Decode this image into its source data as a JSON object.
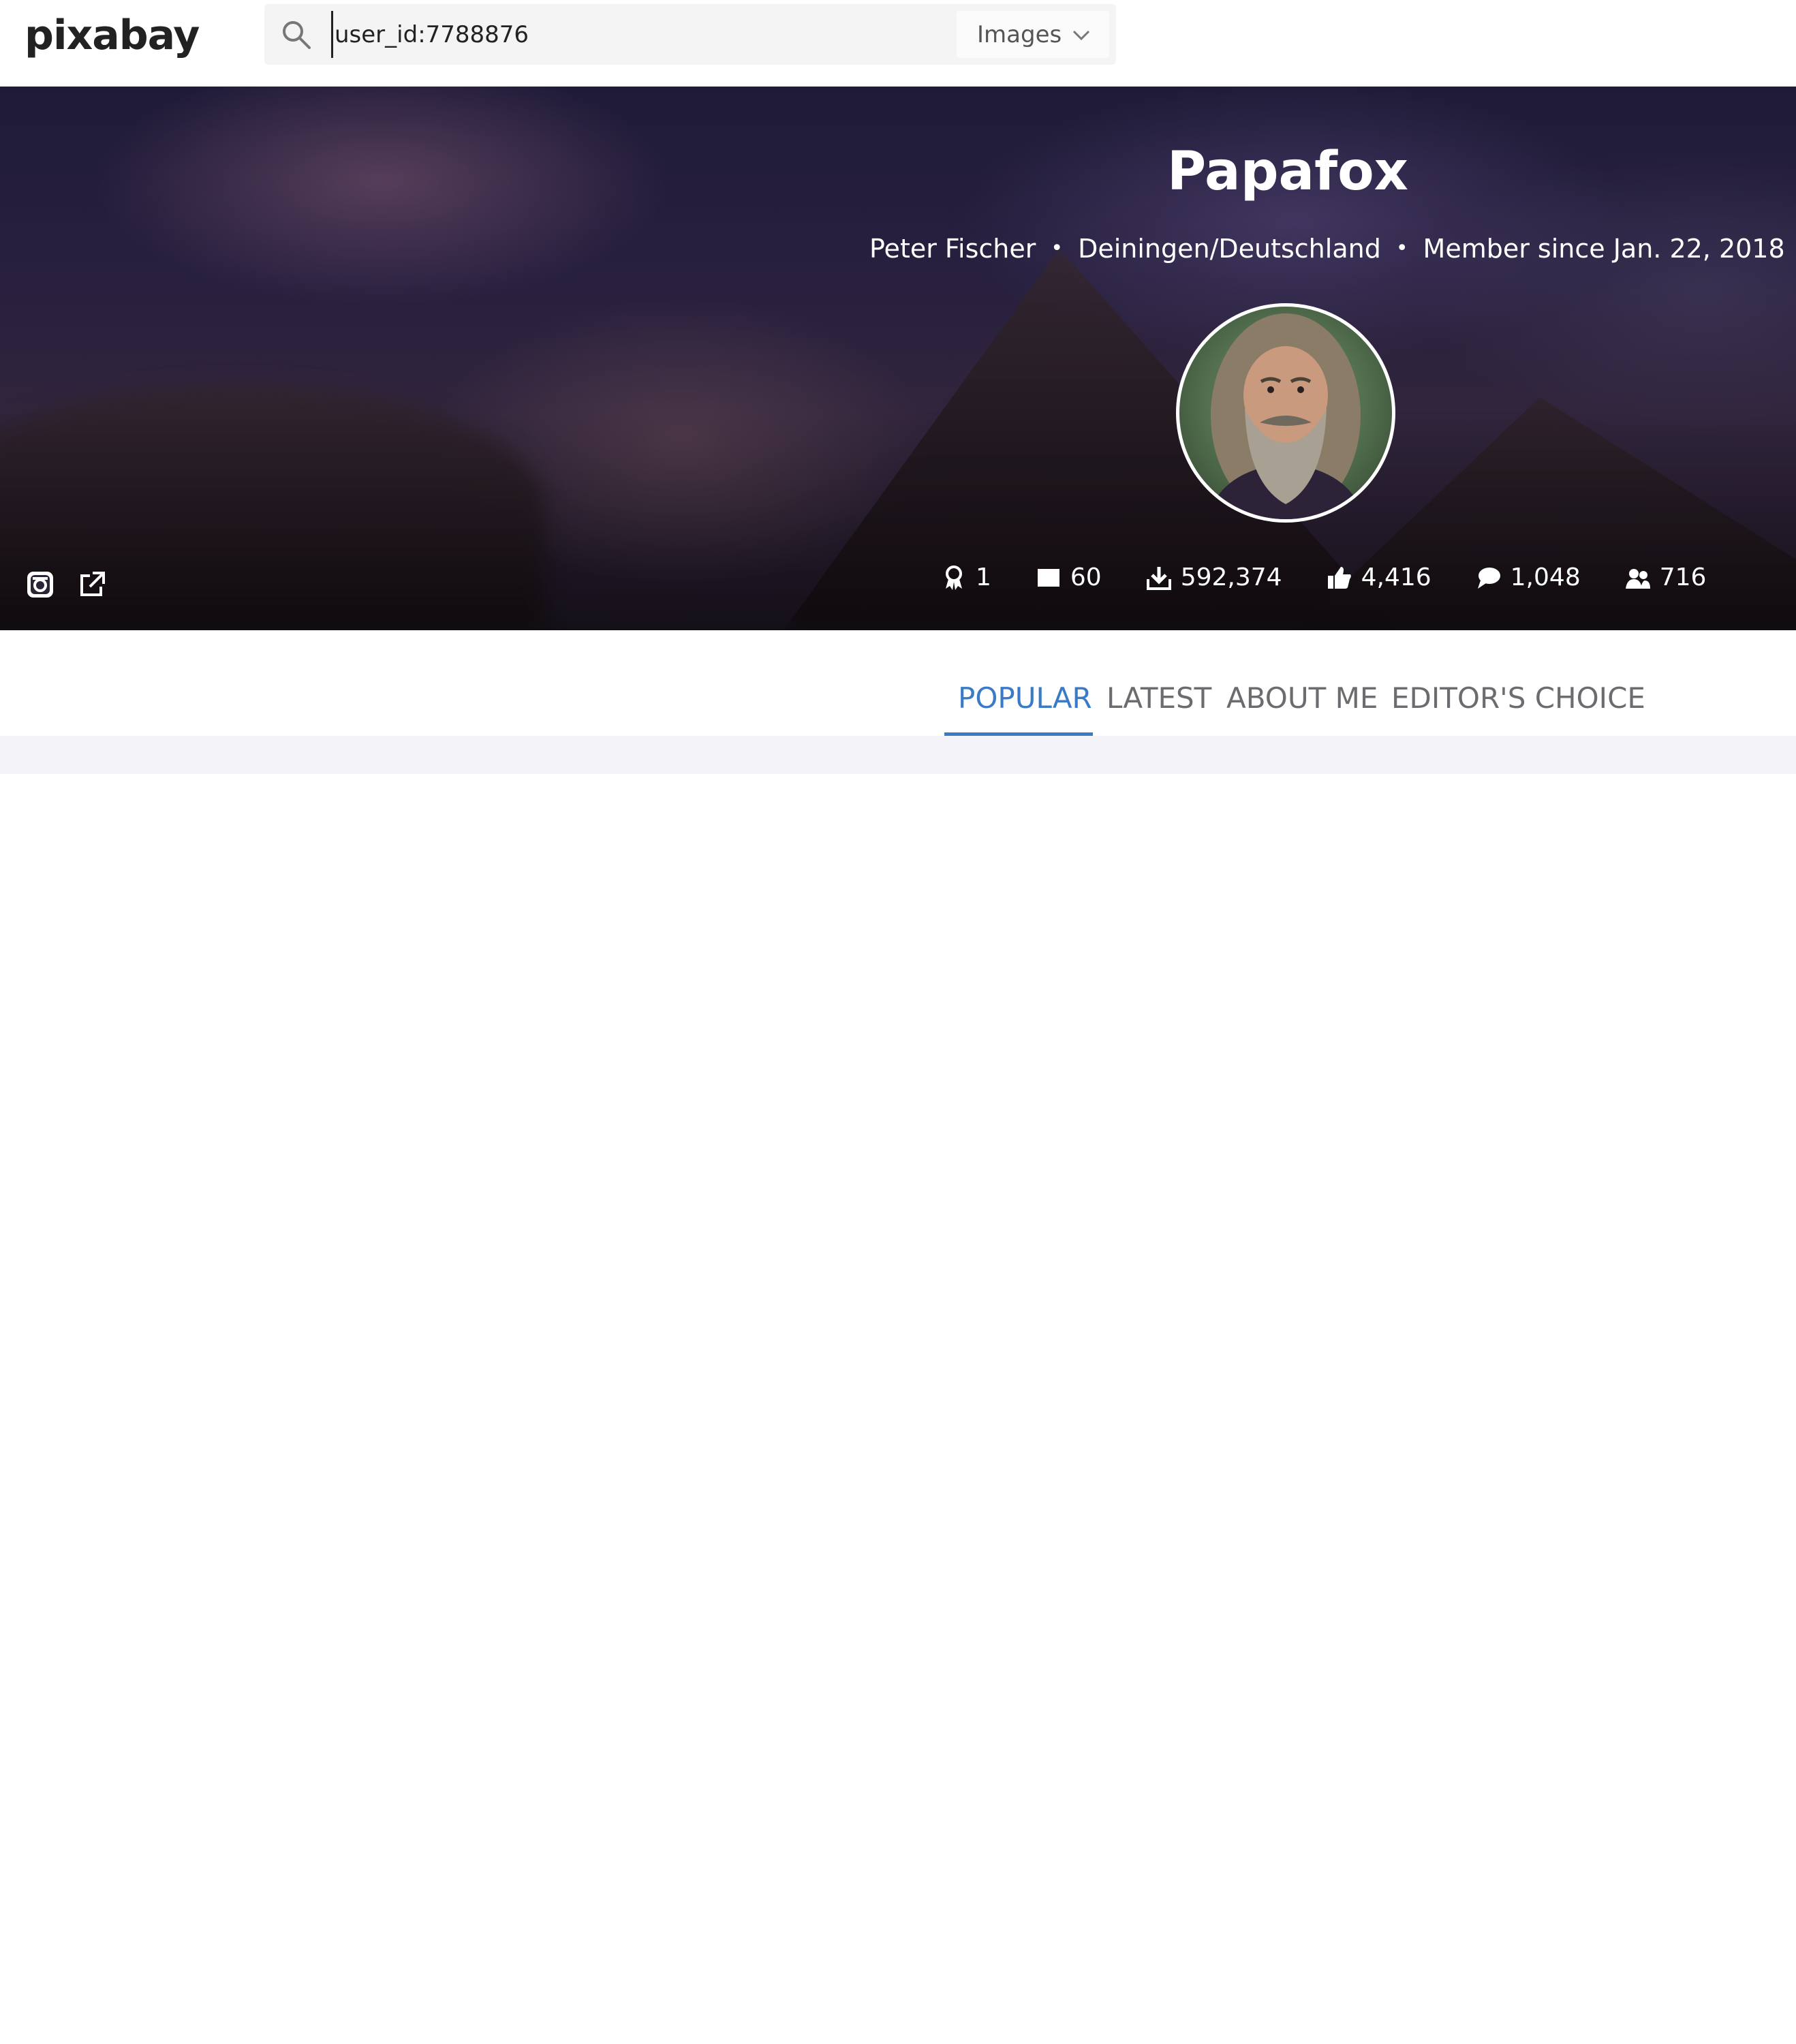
{
  "header": {
    "logo": "pixabay",
    "search": {
      "value": "user_id:7788876"
    },
    "media_type": "Images"
  },
  "profile": {
    "username": "Papafox",
    "full_name": "Peter Fischer",
    "location": "Deiningen/Deutschland",
    "member_since": "Member since Jan. 22, 2018",
    "separator": "•",
    "icons": {
      "social": [
        "instagram-icon",
        "external-link-icon"
      ],
      "stats": [
        "award-icon",
        "image-icon",
        "download-icon",
        "like-icon",
        "comment-icon",
        "followers-icon"
      ]
    },
    "stats": {
      "awards": "1",
      "images": "60",
      "downloads": "592,374",
      "likes": "4,416",
      "comments": "1,048",
      "followers": "716"
    }
  },
  "tabs": {
    "popular": "POPULAR",
    "latest": "LATEST",
    "about": "ABOUT ME",
    "editors_choice": "EDITOR'S CHOICE",
    "active": "POPULAR"
  },
  "colors": {
    "accent": "#3a7bc8",
    "tab_text": "#6b6b70",
    "search_bg": "#f4f4f5"
  }
}
